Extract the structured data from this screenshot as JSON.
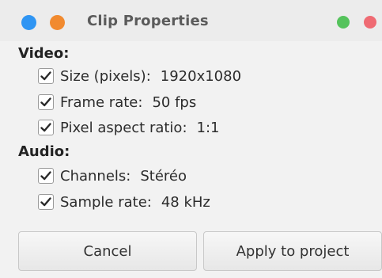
{
  "window": {
    "title": "Clip Properties",
    "controls": {
      "left": [
        {
          "name": "blue",
          "color": "#2f95f3"
        },
        {
          "name": "orange",
          "color": "#f18a2f"
        }
      ],
      "right": [
        {
          "name": "green",
          "color": "#55c35c"
        },
        {
          "name": "red",
          "color": "#ef6b73"
        }
      ]
    }
  },
  "video": {
    "heading": "Video:",
    "items": [
      {
        "label": "Size (pixels):",
        "value": "1920x1080",
        "checked": true
      },
      {
        "label": "Frame rate:",
        "value": "50 fps",
        "checked": true
      },
      {
        "label": "Pixel aspect ratio:",
        "value": "1:1",
        "checked": true
      }
    ]
  },
  "audio": {
    "heading": "Audio:",
    "items": [
      {
        "label": "Channels:",
        "value": "Stéréo",
        "checked": true
      },
      {
        "label": "Sample rate:",
        "value": "48 kHz",
        "checked": true
      }
    ]
  },
  "buttons": {
    "cancel": "Cancel",
    "apply": "Apply to project"
  },
  "colors": {
    "accent_check": "#2a2a2a",
    "background": "#f2f2f2"
  }
}
